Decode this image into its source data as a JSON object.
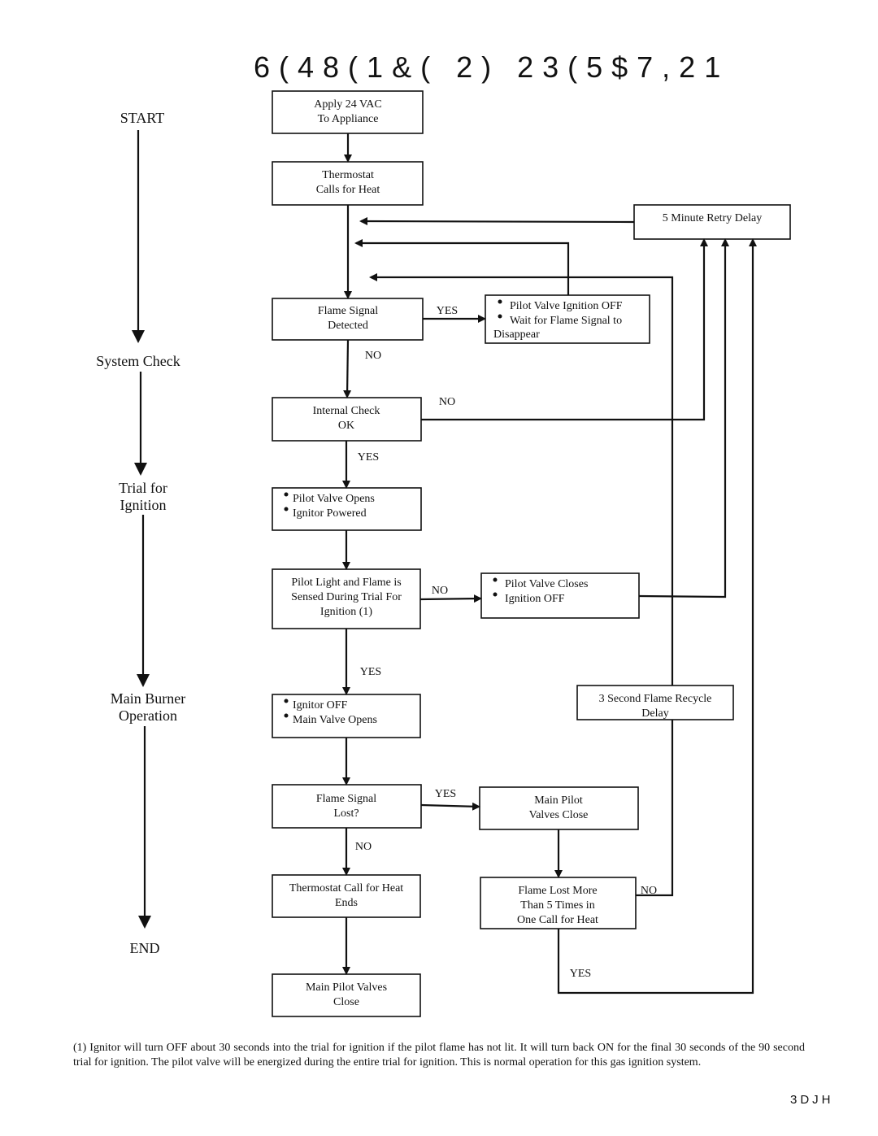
{
  "title": "6(48(1&( 2) 23(5$7,21",
  "stages": {
    "start": "START",
    "system_check": "System Check",
    "trial_1": "Trial for",
    "trial_2": "Ignition",
    "main_1": "Main Burner",
    "main_2": "Operation",
    "end": "END"
  },
  "boxes": {
    "apply": [
      "Apply 24 VAC",
      "To Appliance"
    ],
    "thermostat": [
      "Thermostat",
      "Calls for Heat"
    ],
    "retry": [
      "5 Minute Retry Delay"
    ],
    "flame_detected": [
      "Flame Signal",
      "Detected"
    ],
    "pilot_off": [
      "Pilot Valve Ignition OFF",
      "Wait for Flame Signal to",
      "Disappear"
    ],
    "internal": [
      "Internal Check",
      "OK"
    ],
    "pilot_opens": [
      "Pilot Valve Opens",
      "Ignitor Powered"
    ],
    "pilot_light": [
      "Pilot Light and Flame is",
      "Sensed During Trial For",
      "Ignition (1)"
    ],
    "pilot_closes": [
      "Pilot Valve Closes",
      "Ignition OFF"
    ],
    "recycle": [
      "3 Second Flame Recycle",
      "Delay"
    ],
    "ignitor_off": [
      "Ignitor OFF",
      "Main Valve Opens"
    ],
    "flame_lost": [
      "Flame Signal",
      "Lost?"
    ],
    "main_pilot_close": [
      "Main Pilot",
      "Valves Close"
    ],
    "thermostat_ends": [
      "Thermostat Call for Heat",
      "Ends"
    ],
    "flame_lost_more": [
      "Flame Lost More",
      "Than 5 Times in",
      "One Call for Heat"
    ],
    "main_pilot_close_end": [
      "Main Pilot Valves",
      "Close"
    ]
  },
  "labels": {
    "yes": "YES",
    "no": "NO"
  },
  "footnote": "(1) Ignitor will turn OFF about 30 seconds into the trial for ignition if the pilot flame has not lit. It will turn back ON for the final 30 seconds of the 90 second trial for ignition. The pilot valve will be energized during the entire trial for ignition. This is normal operation for this gas ignition system.",
  "page_label": "3DJH"
}
